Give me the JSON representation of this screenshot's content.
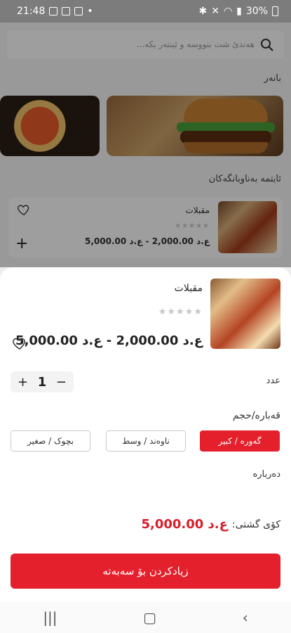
{
  "status_bar": {
    "time": "21:48",
    "battery": "30%"
  },
  "search": {
    "placeholder": "هەندێ شت بنووسە و ئینتەر بکە..."
  },
  "sections": {
    "banner_title": "بانەر",
    "favorites_title": "ئایتمە بەناوبانگەکان"
  },
  "card": {
    "name": "مقبلات",
    "stars": "★★★★★",
    "price": "ع.د 2,000.00 - ع.د 5,000.00"
  },
  "product": {
    "name": "مقبلات",
    "stars": "★★★★★",
    "price": "ع.د 2,000.00 - ع.د 5,000.00",
    "quantity_label": "عدد",
    "quantity": "1",
    "size_label": "قەبارە/حجم",
    "sizes": [
      {
        "label": "گەورە / کبير",
        "selected": true
      },
      {
        "label": "ناوەند / وسط",
        "selected": false
      },
      {
        "label": "بچوک / صغير",
        "selected": false
      }
    ],
    "about_label": "دەربارە",
    "total_label": "کۆی گشتی:",
    "total_value": "ع.د 5,000.00",
    "add_button": "زیادکردن بۆ سەبەتە"
  },
  "colors": {
    "accent": "#e4202d",
    "price_red": "#d91d2a"
  }
}
